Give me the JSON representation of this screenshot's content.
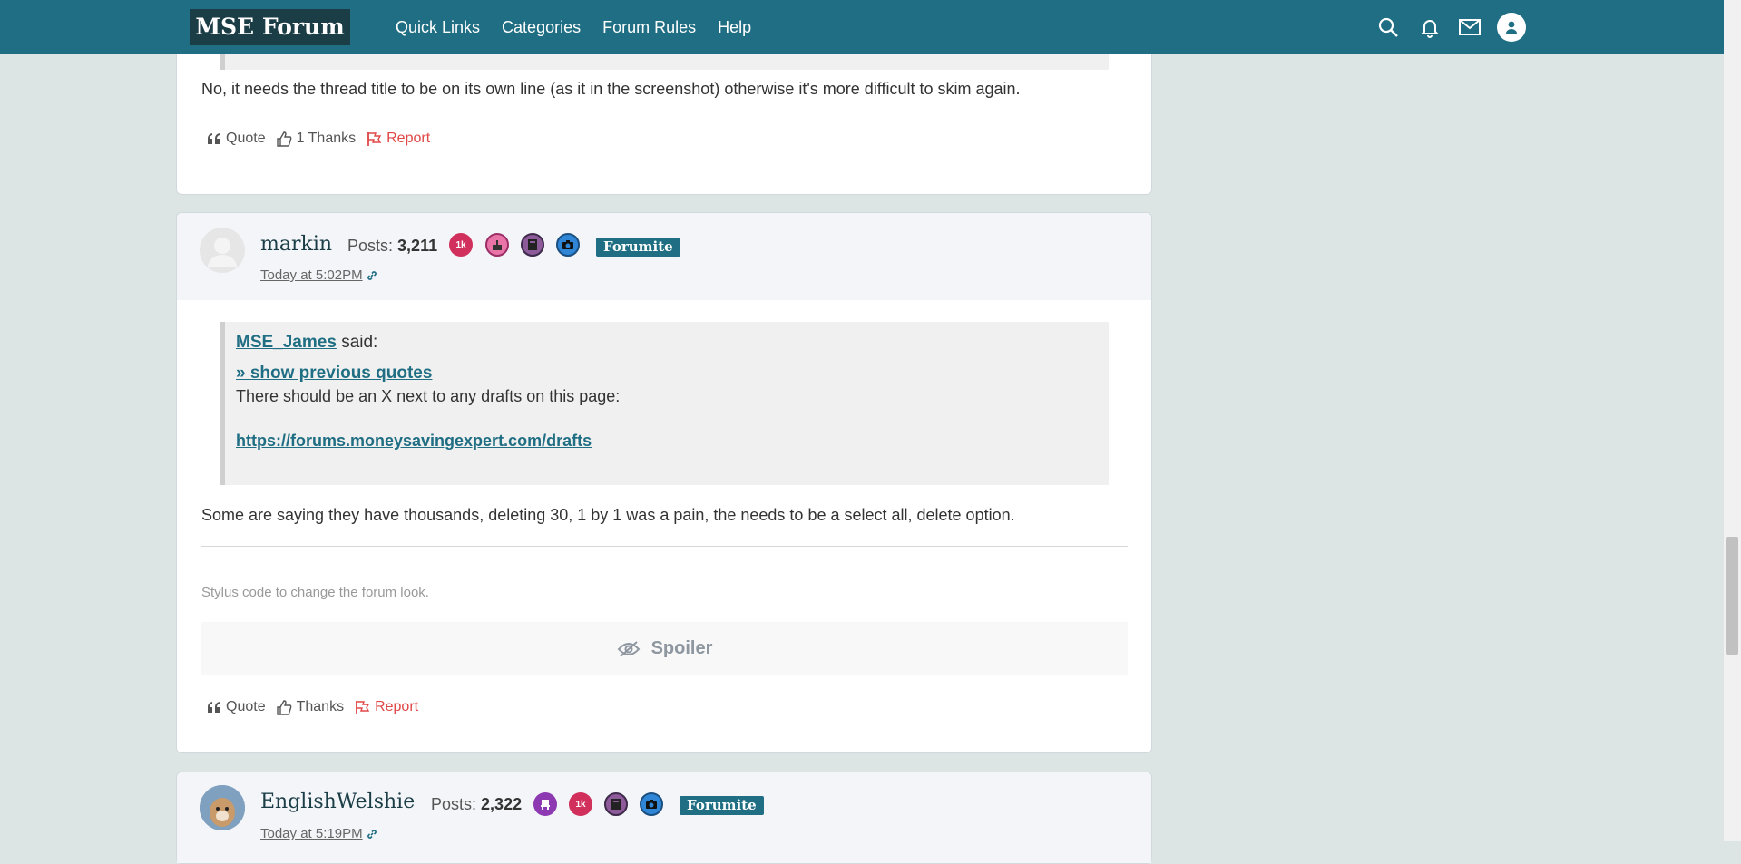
{
  "header": {
    "logo": "MSE Forum",
    "nav": [
      "Quick Links",
      "Categories",
      "Forum Rules",
      "Help"
    ]
  },
  "post_prev": {
    "body": "No, it needs the thread title to be on its own line (as it in the screenshot) otherwise it's more difficult to skim again.",
    "actions": {
      "quote": "Quote",
      "thanks": "1 Thanks",
      "report": "Report"
    }
  },
  "post_markin": {
    "username": "markin",
    "posts_label": "Posts:",
    "posts_count": "3,211",
    "badge_1k": "1k",
    "rank": "Forumite",
    "timestamp": "Today at 5:02PM",
    "quote": {
      "author": "MSE_James",
      "said": "said:",
      "show_prev": "» show previous quotes",
      "text": "There should be an X next to any drafts on this page:",
      "link": "https://forums.moneysavingexpert.com/drafts"
    },
    "body": "Some are saying they have thousands, deleting 30, 1 by 1 was a pain, the needs to be a select all, delete option.",
    "signature": "Stylus code to change the forum look.",
    "spoiler": "Spoiler",
    "actions": {
      "quote": "Quote",
      "thanks": "Thanks",
      "report": "Report"
    }
  },
  "post_welshie": {
    "username": "EnglishWelshie",
    "posts_label": "Posts:",
    "posts_count": "2,322",
    "badge_1k": "1k",
    "rank": "Forumite",
    "timestamp": "Today at 5:19PM"
  },
  "colors": {
    "header": "#1f6e83",
    "logo_bg": "#1b3d46",
    "report": "#e04848",
    "background": "#dde5e4"
  }
}
